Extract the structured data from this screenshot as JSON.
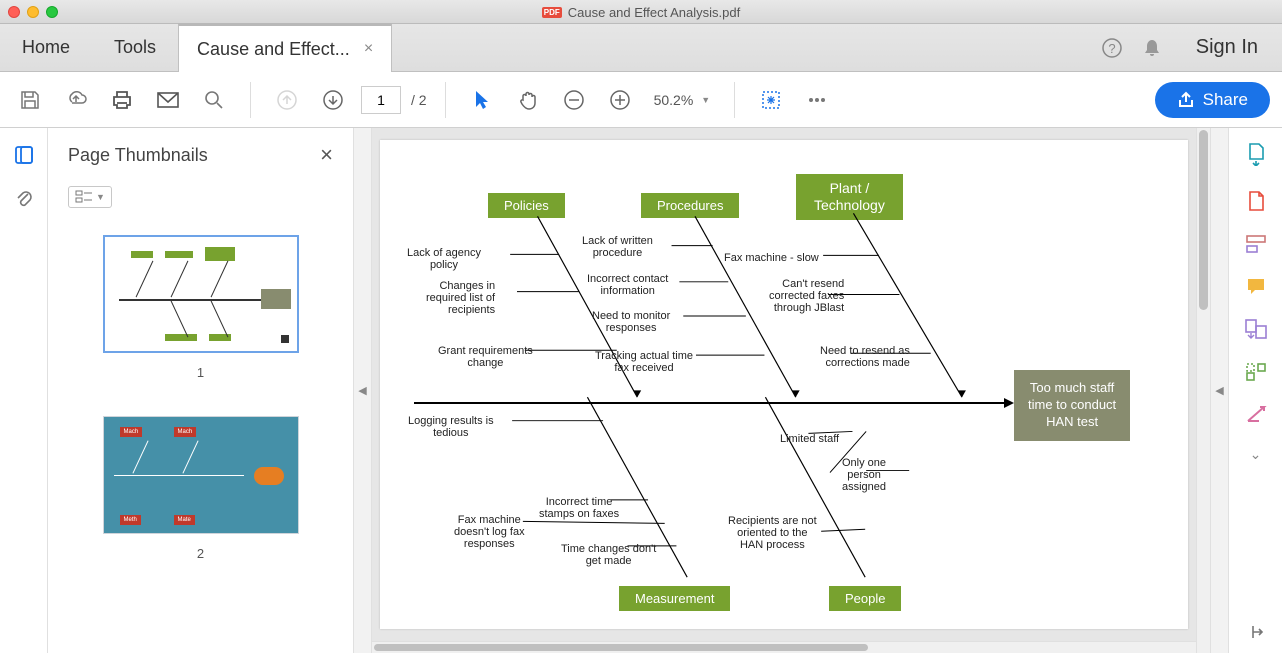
{
  "window_title": "Cause and Effect Analysis.pdf",
  "tabs": {
    "home": "Home",
    "tools": "Tools",
    "doc": "Cause and Effect..."
  },
  "signin": "Sign In",
  "toolbar": {
    "page_current": "1",
    "page_total": "/ 2",
    "zoom": "50.2%",
    "share": "Share"
  },
  "thumbnails": {
    "title": "Page Thumbnails",
    "pages": [
      "1",
      "2"
    ]
  },
  "fishbone": {
    "effect": "Too much staff\ntime to conduct\nHAN test",
    "categories": {
      "policies": "Policies",
      "procedures": "Procedures",
      "plant": "Plant /\nTechnology",
      "measurement": "Measurement",
      "people": "People"
    },
    "causes": {
      "policies": [
        "Lack of agency\npolicy",
        "Changes in\nrequired list of\nrecipients",
        "Grant requirements\nchange"
      ],
      "procedures": [
        "Lack of written\nprocedure",
        "Incorrect contact\ninformation",
        "Need to monitor\nresponses",
        "Tracking actual time\nfax received"
      ],
      "plant": [
        "Fax machine - slow",
        "Can't resend\ncorrected faxes\nthrough JBlast",
        "Need to resend as\ncorrections made"
      ],
      "measurement": [
        "Logging results is\ntedious",
        "Fax machine\ndoesn't log fax\nresponses",
        "Incorrect time\nstamps on faxes",
        "Time changes don't\nget made"
      ],
      "people": [
        "Limited staff",
        "Only one\nperson\nassigned",
        "Recipients are not\noriented to the\nHAN process"
      ]
    }
  }
}
